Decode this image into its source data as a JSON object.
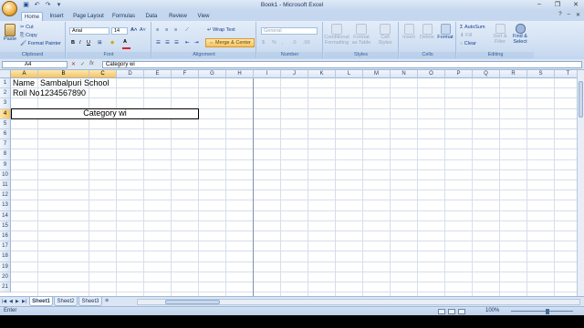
{
  "window": {
    "title": "Book1 - Microsoft Excel"
  },
  "tabs": [
    "Home",
    "Insert",
    "Page Layout",
    "Formulas",
    "Data",
    "Review",
    "View"
  ],
  "ribbon": {
    "clipboard": {
      "label": "Clipboard",
      "paste": "Paste",
      "cut": "Cut",
      "copy": "Copy",
      "format_painter": "Format Painter"
    },
    "font": {
      "label": "Font",
      "family": "Arial",
      "size": "14"
    },
    "alignment": {
      "label": "Alignment",
      "wrap_text": "Wrap Text",
      "merge_center": "Merge & Center"
    },
    "number": {
      "label": "Number",
      "format": "General"
    },
    "styles": {
      "label": "Styles",
      "conditional_1": "Conditional",
      "conditional_2": "Formatting",
      "format_table_1": "Format",
      "format_table_2": "as Table",
      "cell_styles_1": "Cell",
      "cell_styles_2": "Styles"
    },
    "cells": {
      "label": "Cells",
      "insert": "Insert",
      "delete": "Delete",
      "format": "Format"
    },
    "editing": {
      "label": "Editing",
      "autosum": "AutoSum",
      "fill": "Fill",
      "clear": "Clear",
      "sort_1": "Sort &",
      "sort_2": "Filter",
      "find_1": "Find &",
      "find_2": "Select"
    }
  },
  "formula_bar": {
    "name_box": "A4",
    "fx": "fx",
    "content": "Category wi"
  },
  "columns": [
    "A",
    "B",
    "C",
    "D",
    "E",
    "F",
    "G",
    "H",
    "I",
    "J",
    "K",
    "L",
    "M",
    "N",
    "O",
    "P",
    "Q",
    "R",
    "S",
    "T"
  ],
  "rows": [
    "1",
    "2",
    "3",
    "4",
    "5",
    "6",
    "7",
    "8",
    "9",
    "10",
    "11",
    "12",
    "13",
    "14",
    "15",
    "16",
    "17",
    "18",
    "19",
    "20",
    "21"
  ],
  "cells": {
    "A1": "Name",
    "B1": "Sambalpuri School",
    "A2": "Roll No",
    "B2": "1234567890",
    "A4": "Category wi"
  },
  "sheet_tabs": [
    "Sheet1",
    "Sheet2",
    "Sheet3"
  ],
  "status": {
    "mode": "Enter",
    "zoom": "100%"
  },
  "colors": {
    "selected_header": "#f6c35e",
    "ribbon": "#cfdff2"
  }
}
